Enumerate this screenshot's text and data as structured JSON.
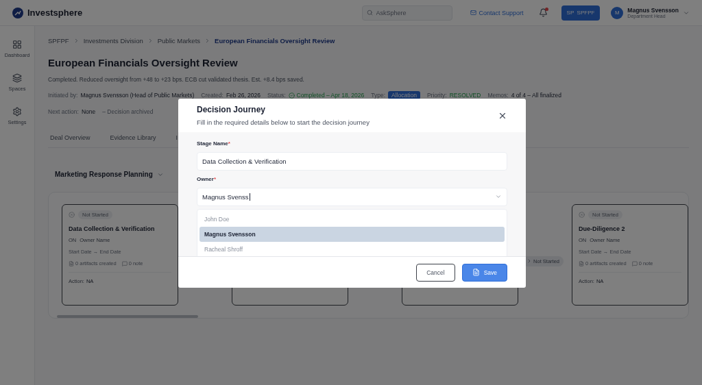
{
  "app": {
    "name": "Investsphere"
  },
  "header": {
    "search_placeholder": "AskSphere",
    "support": "Contact Support",
    "unread": true,
    "workspace": "SP  SPFPF",
    "user": {
      "initial": "M",
      "name": "Magnus Svensson",
      "role": "Department Head"
    }
  },
  "sidebar": [
    {
      "label": "Dashboard",
      "kind": "dashboard"
    },
    {
      "label": "Spaces",
      "kind": "spaces"
    },
    {
      "label": "Settings",
      "kind": "settings"
    }
  ],
  "breadcrumbs": [
    {
      "label": "SPFPF",
      "current": false
    },
    {
      "label": "Investments Division",
      "current": false
    },
    {
      "label": "Public Markets",
      "current": false
    },
    {
      "label": "European Financials Oversight Review",
      "current": true
    }
  ],
  "title": "European Financials Oversight Review",
  "summary": "Completed. Reduced oversight from +48 to +23 bps. ECB cut validated thesis. Est. +8.4 bps saved.",
  "meta": [
    {
      "label": "Initiated by:",
      "value": "Magnus Svensson (Head of Public Markets)",
      "kind": "text"
    },
    {
      "label": "Created:",
      "value": "Feb 26, 2026",
      "kind": "text"
    },
    {
      "label": "Status:",
      "value": "Completed – Apr 18, 2026",
      "kind": "status"
    },
    {
      "label": "Type:",
      "value": "Allocation",
      "kind": "tag"
    },
    {
      "label": "Priority:",
      "value": "RESOLVED",
      "kind": "priority"
    },
    {
      "label": "Memos:",
      "value": "4 of 4 – All finalized",
      "kind": "text"
    }
  ],
  "next_action": {
    "label": "Next action:",
    "value": "None",
    "note": "–  Decision archived"
  },
  "tabs": [
    {
      "label": "Deal Overview",
      "selected": false
    },
    {
      "label": "Evidence Library",
      "selected": false
    },
    {
      "label": "I",
      "selected": false
    }
  ],
  "journey": {
    "selector": "Marketing Response Planning",
    "stages": [
      {
        "kind": "card",
        "status": "Not Started",
        "title": "Data Collection & Verification",
        "initials": "ON",
        "owner": "Owner Name",
        "dates": "Start Date → End Date",
        "artifacts": "0 artifacts created",
        "notes": "0 note",
        "action_label": "Action:",
        "action": "NA"
      },
      {
        "kind": "covered"
      },
      {
        "kind": "covered"
      },
      {
        "kind": "card",
        "incoming": "Not Started",
        "status": "Not Started",
        "title": "Due-Diligence 2",
        "initials": "ON",
        "owner": "Owner Name",
        "dates": "Start Date → End Date",
        "artifacts": "0 artifacts created",
        "notes": "0 note",
        "action_label": "Action:",
        "action": "NA"
      }
    ]
  },
  "modal": {
    "title": "Decision Journey",
    "subtitle": "Fill in the required details below to start the decision journey",
    "stage_field": {
      "label": "Stage Name",
      "required_mark": "*",
      "value": "Data Collection & Verification"
    },
    "owner_field": {
      "label": "Owner",
      "required_mark": "*",
      "value": "Magnus Svenss",
      "expanded": true,
      "options": [
        {
          "label": "John Doe",
          "selected": false
        },
        {
          "label": "Magnus Svensson",
          "selected": true
        },
        {
          "label": "Racheal Shroff",
          "selected": false
        }
      ]
    },
    "buttons": [
      {
        "label": "Cancel",
        "kind": "secondary"
      },
      {
        "label": "Save",
        "kind": "primary"
      }
    ]
  }
}
